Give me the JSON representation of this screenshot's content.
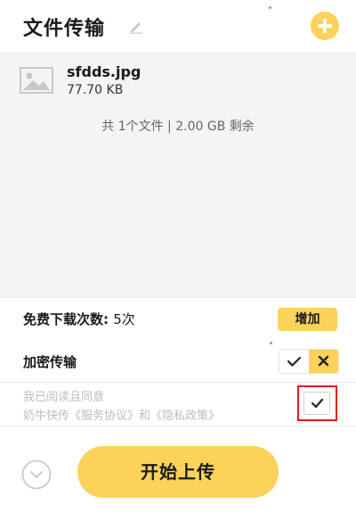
{
  "header": {
    "title": "文件传输",
    "edit_icon": "pencil-icon",
    "add_icon": "plus-circle-icon"
  },
  "file_area": {
    "files": [
      {
        "name": "sfdds.jpg",
        "size": "77.70 KB",
        "icon": "image-icon"
      }
    ],
    "summary": "共 1个文件 | 2.00 GB 剩余"
  },
  "downloads": {
    "label": "免费下载次数:",
    "value": "5次",
    "button_label": "增加"
  },
  "encryption": {
    "label": "加密传输",
    "on_icon": "check-icon",
    "off_icon": "x-icon",
    "enabled": false
  },
  "agreement": {
    "line1": "我已阅读且同意",
    "line2_prefix": "奶牛快传",
    "terms_link": "《服务协议》",
    "and_text": "和",
    "privacy_link": "《隐私政策》",
    "checked": true
  },
  "footer": {
    "expand_icon": "chevron-down-circle-icon",
    "upload_label": "开始上传"
  },
  "colors": {
    "accent": "#fcd25a",
    "file_area_bg": "#f4f4f5",
    "highlight_border": "#e01b1b",
    "muted_text": "#bdbdbd"
  }
}
